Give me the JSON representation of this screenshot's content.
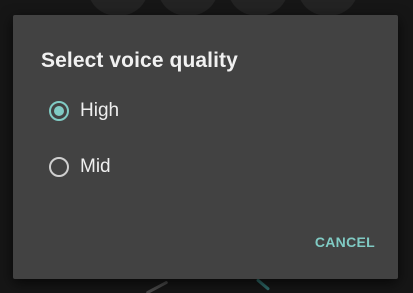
{
  "dialog": {
    "title": "Select voice quality",
    "options": [
      {
        "label": "High",
        "selected": true
      },
      {
        "label": "Mid",
        "selected": false
      }
    ],
    "cancel_label": "CANCEL"
  },
  "colors": {
    "accent": "#80cbc4",
    "dialog_background": "#424242",
    "backdrop": "#161616"
  },
  "icons": {
    "selected": "radio-checked-icon",
    "unselected": "radio-unchecked-icon"
  }
}
